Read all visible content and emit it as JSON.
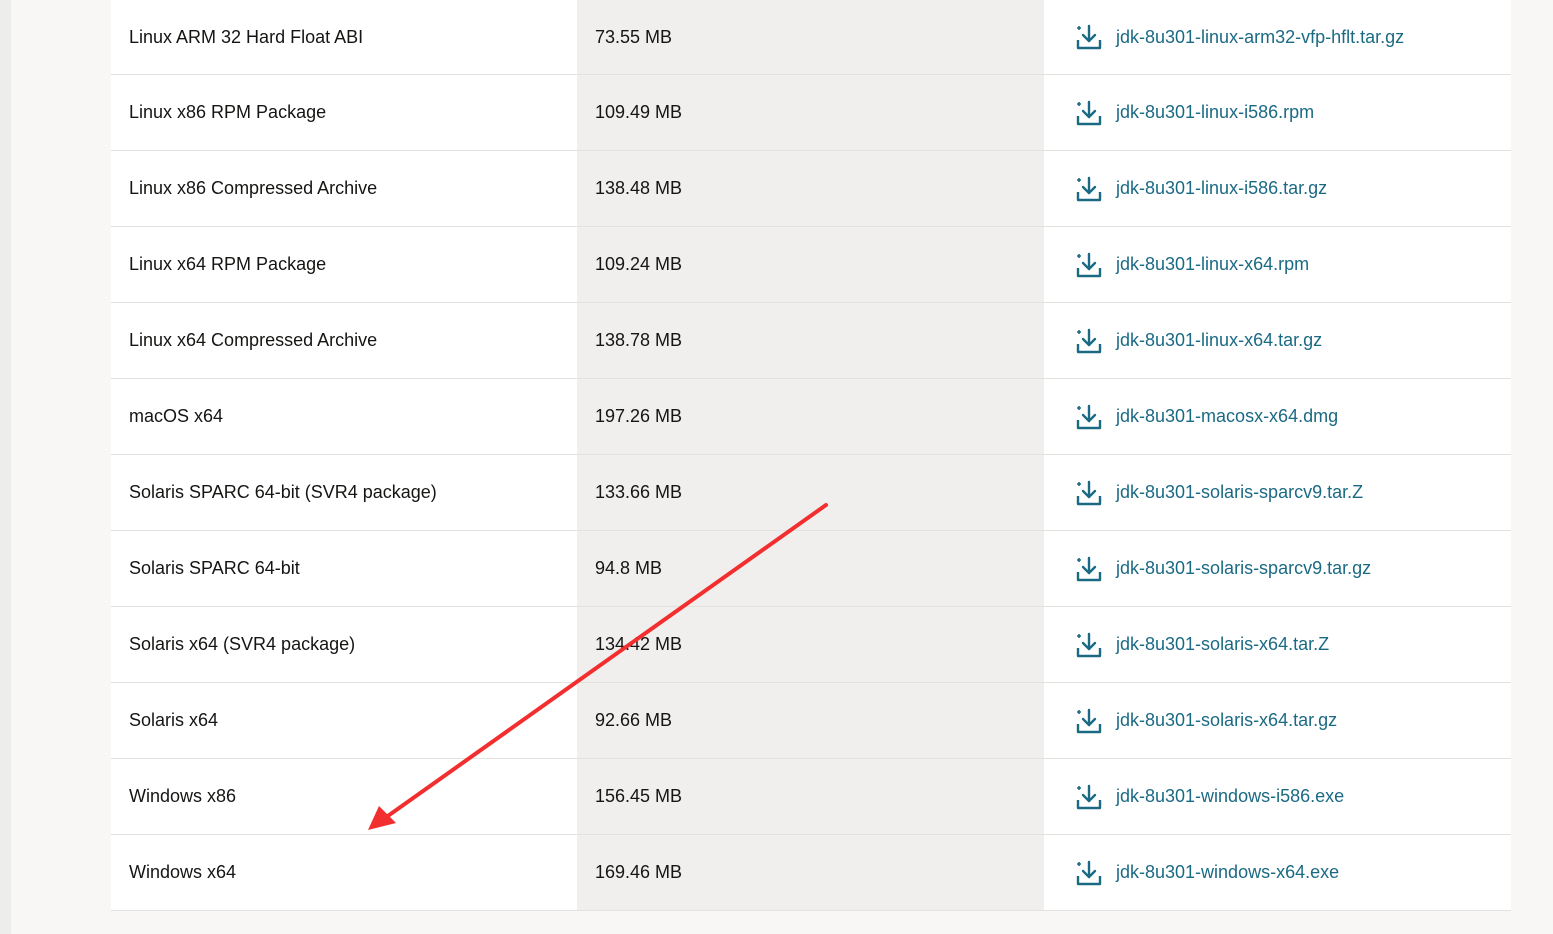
{
  "downloads": [
    {
      "product": "Linux ARM 32 Hard Float ABI",
      "size": "73.55 MB",
      "file": "jdk-8u301-linux-arm32-vfp-hflt.tar.gz"
    },
    {
      "product": "Linux x86 RPM Package",
      "size": "109.49 MB",
      "file": "jdk-8u301-linux-i586.rpm"
    },
    {
      "product": "Linux x86 Compressed Archive",
      "size": "138.48 MB",
      "file": "jdk-8u301-linux-i586.tar.gz"
    },
    {
      "product": "Linux x64 RPM Package",
      "size": "109.24 MB",
      "file": "jdk-8u301-linux-x64.rpm"
    },
    {
      "product": "Linux x64 Compressed Archive",
      "size": "138.78 MB",
      "file": "jdk-8u301-linux-x64.tar.gz"
    },
    {
      "product": "macOS x64",
      "size": "197.26 MB",
      "file": "jdk-8u301-macosx-x64.dmg"
    },
    {
      "product": "Solaris SPARC 64-bit (SVR4 package)",
      "size": "133.66 MB",
      "file": "jdk-8u301-solaris-sparcv9.tar.Z"
    },
    {
      "product": "Solaris SPARC 64-bit",
      "size": "94.8 MB",
      "file": "jdk-8u301-solaris-sparcv9.tar.gz"
    },
    {
      "product": "Solaris x64 (SVR4 package)",
      "size": "134.42 MB",
      "file": "jdk-8u301-solaris-x64.tar.Z"
    },
    {
      "product": "Solaris x64",
      "size": "92.66 MB",
      "file": "jdk-8u301-solaris-x64.tar.gz"
    },
    {
      "product": "Windows x86",
      "size": "156.45 MB",
      "file": "jdk-8u301-windows-i586.exe"
    },
    {
      "product": "Windows x64",
      "size": "169.46 MB",
      "file": "jdk-8u301-windows-x64.exe"
    }
  ],
  "icons": {
    "download": "download-icon"
  },
  "colors": {
    "link": "#1b6a84",
    "annotation_arrow": "#f22e2e"
  }
}
